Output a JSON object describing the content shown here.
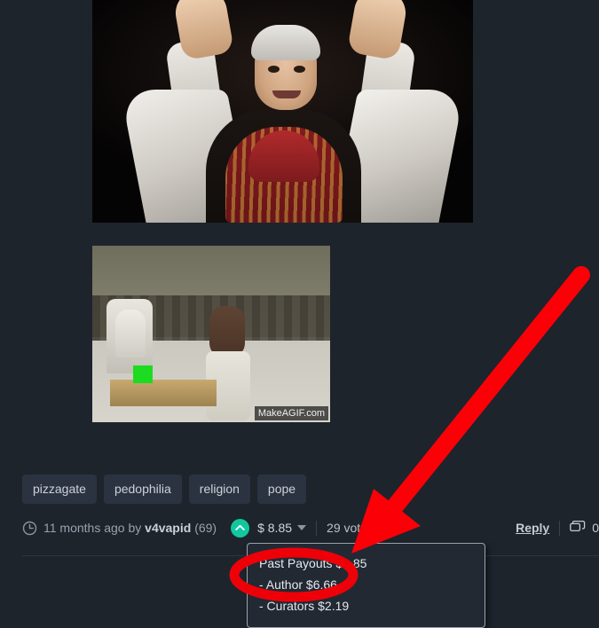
{
  "post": {
    "media": [
      {
        "name": "pope-photo",
        "alt": "Pope Benedict XVI with both hands raised"
      },
      {
        "name": "pope-gif",
        "alt": "Animated GIF of a dancer performing before the Pope",
        "watermark": "MakeAGIF.com"
      }
    ],
    "tags": [
      "pizzagate",
      "pedophilia",
      "religion",
      "pope"
    ],
    "meta": {
      "clock_icon": "clock-icon",
      "age": "11 months ago by",
      "author": "v4vapid",
      "reputation": "(69)",
      "upvote_icon": "chevron-up-icon",
      "payout": "$ 8.85",
      "payout_caret_icon": "chevron-down-icon",
      "votes": "29 votes",
      "votes_caret_icon": "chevron-down-icon",
      "reply_label": "Reply",
      "comments_icon": "comment-bubble-icon",
      "comment_count": "0"
    },
    "payout_popup": {
      "title": "Past Payouts $8.85",
      "lines": [
        "- Author $6.66",
        "- Curators $2.19"
      ]
    }
  },
  "annotations": {
    "arrow": {
      "name": "red-arrow",
      "color": "#fb0007",
      "target": "payout-popup"
    },
    "ellipse": {
      "name": "red-ellipse",
      "color": "#ee0008",
      "target": "author-payout-line"
    }
  },
  "theme": {
    "background": "#1d242c",
    "tag_background": "#2b3340",
    "upvote_green": "#12c79f",
    "text_primary": "#cfd6dd",
    "text_muted": "#98a2ae"
  }
}
